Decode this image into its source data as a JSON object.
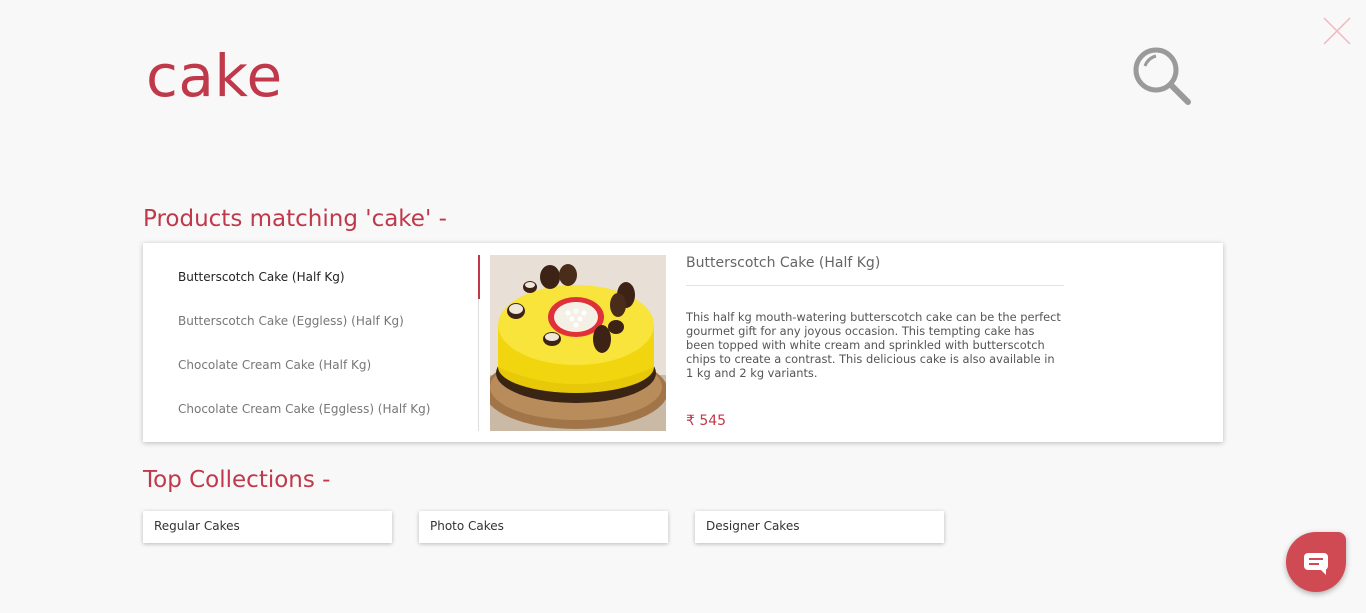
{
  "search": {
    "query": "cake"
  },
  "products_section": {
    "heading": "Products matching 'cake' -",
    "items": [
      {
        "label": "Butterscotch Cake (Half Kg)"
      },
      {
        "label": "Butterscotch Cake (Eggless) (Half Kg)"
      },
      {
        "label": "Chocolate Cream Cake (Half Kg)"
      },
      {
        "label": "Chocolate Cream Cake (Eggless) (Half Kg)"
      }
    ],
    "selected": {
      "title": "Butterscotch Cake (Half Kg)",
      "description": "This half kg mouth-watering butterscotch cake can be the perfect gourmet gift for any joyous occasion. This tempting cake has been topped with white cream and sprinkled with butterscotch chips to create a contrast. This delicious cake is also available in 1 kg and 2 kg variants.",
      "price": "₹ 545"
    }
  },
  "collections_section": {
    "heading": "Top Collections -",
    "items": [
      {
        "label": "Regular Cakes"
      },
      {
        "label": "Photo Cakes"
      },
      {
        "label": "Designer Cakes"
      }
    ]
  },
  "icons": {
    "close": "close-icon",
    "search": "search-icon",
    "chat": "chat-icon"
  },
  "colors": {
    "accent": "#c0394b",
    "chat_button": "#d04a54",
    "background": "#f8f8f8"
  }
}
